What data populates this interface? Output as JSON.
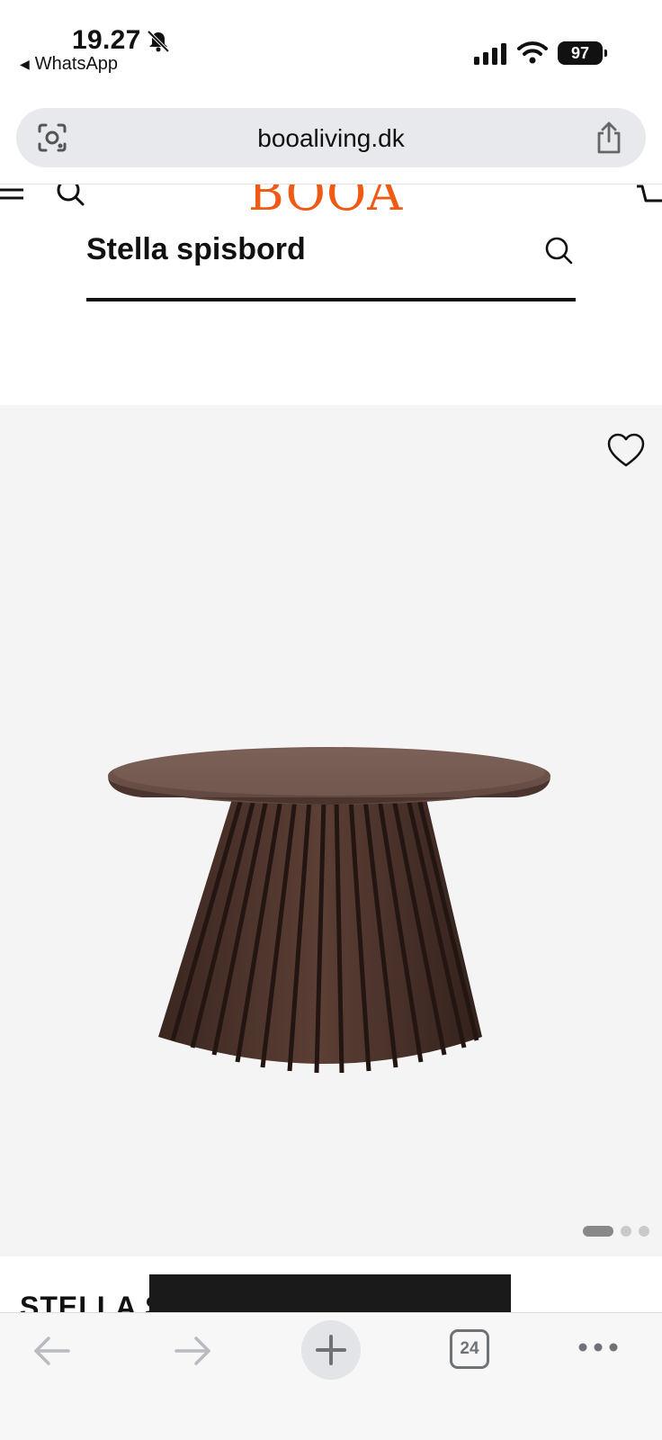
{
  "status_bar": {
    "time": "19.27",
    "back_app": "WhatsApp",
    "battery": "97"
  },
  "browser": {
    "url": "booaliving.dk",
    "open_tabs": "24"
  },
  "site": {
    "logo": "BOOA"
  },
  "search": {
    "query_title": "Stella spisbord"
  },
  "product": {
    "title": "STELLA S",
    "image_dots": {
      "count": 3,
      "active_index": 0
    }
  },
  "colors": {
    "brand_orange": "#f05a14",
    "table_wood": "#5a3d33",
    "product_bg": "#f4f4f4"
  },
  "icons": {
    "status": [
      "bell-off-icon",
      "signal-icon",
      "wifi-icon",
      "battery-icon"
    ],
    "url_bar": [
      "camera-search-icon",
      "share-icon"
    ],
    "header": [
      "menu-icon",
      "search-icon",
      "cart-icon"
    ],
    "product": [
      "heart-icon"
    ],
    "toolbar": [
      "back-arrow-icon",
      "forward-arrow-icon",
      "plus-icon",
      "tabs-icon",
      "more-icon"
    ]
  }
}
